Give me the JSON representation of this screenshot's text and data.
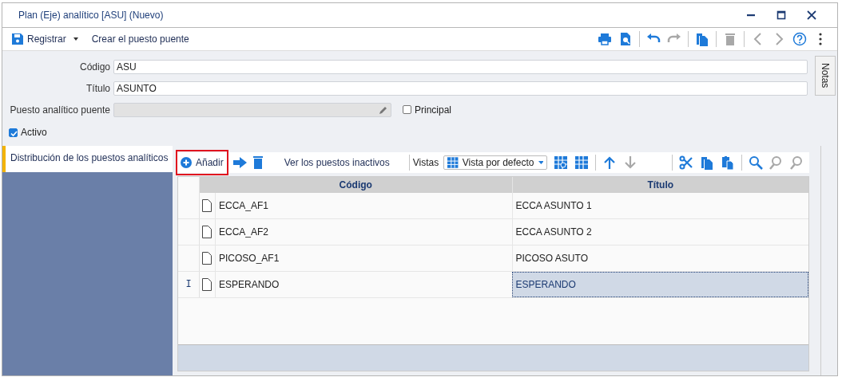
{
  "window": {
    "title": "Plan (Eje) analítico [ASU] (Nuevo)"
  },
  "toolbar": {
    "save_label": "Registrar",
    "create_label": "Crear el puesto puente",
    "icons": [
      {
        "kind": "print",
        "disabled": false
      },
      {
        "kind": "preview",
        "disabled": false
      },
      {
        "kind": "sep"
      },
      {
        "kind": "undo",
        "disabled": false
      },
      {
        "kind": "redo",
        "disabled": true
      },
      {
        "kind": "sep"
      },
      {
        "kind": "copy",
        "disabled": false
      },
      {
        "kind": "sep"
      },
      {
        "kind": "trash",
        "disabled": true
      },
      {
        "kind": "sep"
      },
      {
        "kind": "back",
        "disabled": true
      },
      {
        "kind": "forward",
        "disabled": true
      },
      {
        "kind": "help",
        "disabled": false
      },
      {
        "kind": "more"
      }
    ]
  },
  "form": {
    "fields": [
      {
        "label": "Código",
        "value": "ASU",
        "disabled": false
      },
      {
        "label": "Título",
        "value": "ASUNTO",
        "disabled": false
      },
      {
        "label": "Puesto analítico puente",
        "disabled": true,
        "checkbox": {
          "label": "Principal",
          "checked": false
        }
      }
    ],
    "activo": {
      "label": "Activo",
      "checked": true
    },
    "notes_tab": "Notas"
  },
  "tabs": [
    {
      "label": "Distribución de los puestos analíticos",
      "selected": true
    }
  ],
  "grid_toolbar": {
    "add_label": "Añadir",
    "add_highlighted": true,
    "inactive_label": "Ver los puestos inactivos",
    "views_label": "Vistas",
    "view_value": "Vista por defecto",
    "icons": [
      {
        "kind": "grid-gear",
        "disabled": false
      },
      {
        "kind": "grid-export",
        "disabled": false
      },
      {
        "kind": "sep"
      },
      {
        "kind": "up",
        "disabled": false
      },
      {
        "kind": "down",
        "disabled": true
      },
      {
        "kind": "gap"
      },
      {
        "kind": "sep"
      },
      {
        "kind": "cut",
        "disabled": false
      },
      {
        "kind": "copy",
        "disabled": false
      },
      {
        "kind": "paste",
        "disabled": false
      },
      {
        "kind": "sep"
      },
      {
        "kind": "search",
        "disabled": false
      },
      {
        "kind": "find-prev",
        "disabled": true
      },
      {
        "kind": "find-next",
        "disabled": true
      }
    ]
  },
  "table": {
    "columns": [
      "Código",
      "Título"
    ],
    "rows": [
      {
        "code": "ECCA_AF1",
        "title": "ECCA ASUNTO 1",
        "selected": false
      },
      {
        "code": "ECCA_AF2",
        "title": "ECCA ASUNTO 2",
        "selected": false
      },
      {
        "code": "PICOSO_AF1",
        "title": "PICOSO ASUTO",
        "selected": false
      },
      {
        "indicator": "I",
        "code": "ESPERANDO",
        "title": "ESPERANDO",
        "selected": true
      }
    ]
  }
}
